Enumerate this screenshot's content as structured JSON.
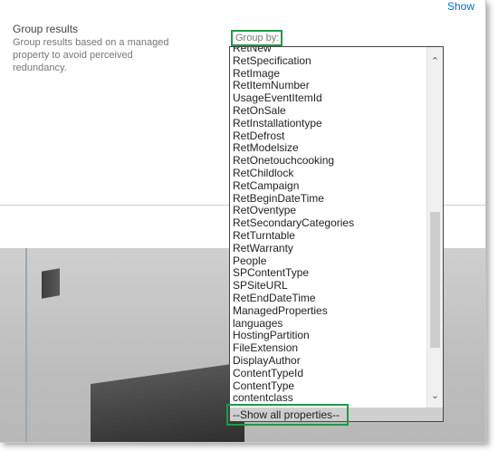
{
  "header": {
    "show_link": "Show"
  },
  "section": {
    "title": "Group results",
    "description": "Group results based on a managed property to avoid perceived redundancy."
  },
  "group_by": {
    "label": "Group by:",
    "options": [
      "RetNew",
      "RetSpecification",
      "RetImage",
      "RetItemNumber",
      "UsageEventItemId",
      "RetOnSale",
      "RetInstallationtype",
      "RetDefrost",
      "RetModelsize",
      "RetOnetouchcooking",
      "RetChildlock",
      "RetCampaign",
      "RetBeginDateTime",
      "RetOventype",
      "RetSecondaryCategories",
      "RetTurntable",
      "RetWarranty",
      "People",
      "SPContentType",
      "SPSiteURL",
      "RetEndDateTime",
      "ManagedProperties",
      "languages",
      "HostingPartition",
      "FileExtension",
      "DisplayAuthor",
      "ContentTypeId",
      "ContentType",
      "contentclass"
    ],
    "show_all": "--Show all properties--"
  },
  "colors": {
    "highlight": "#1f9a48",
    "link": "#0072c6"
  }
}
